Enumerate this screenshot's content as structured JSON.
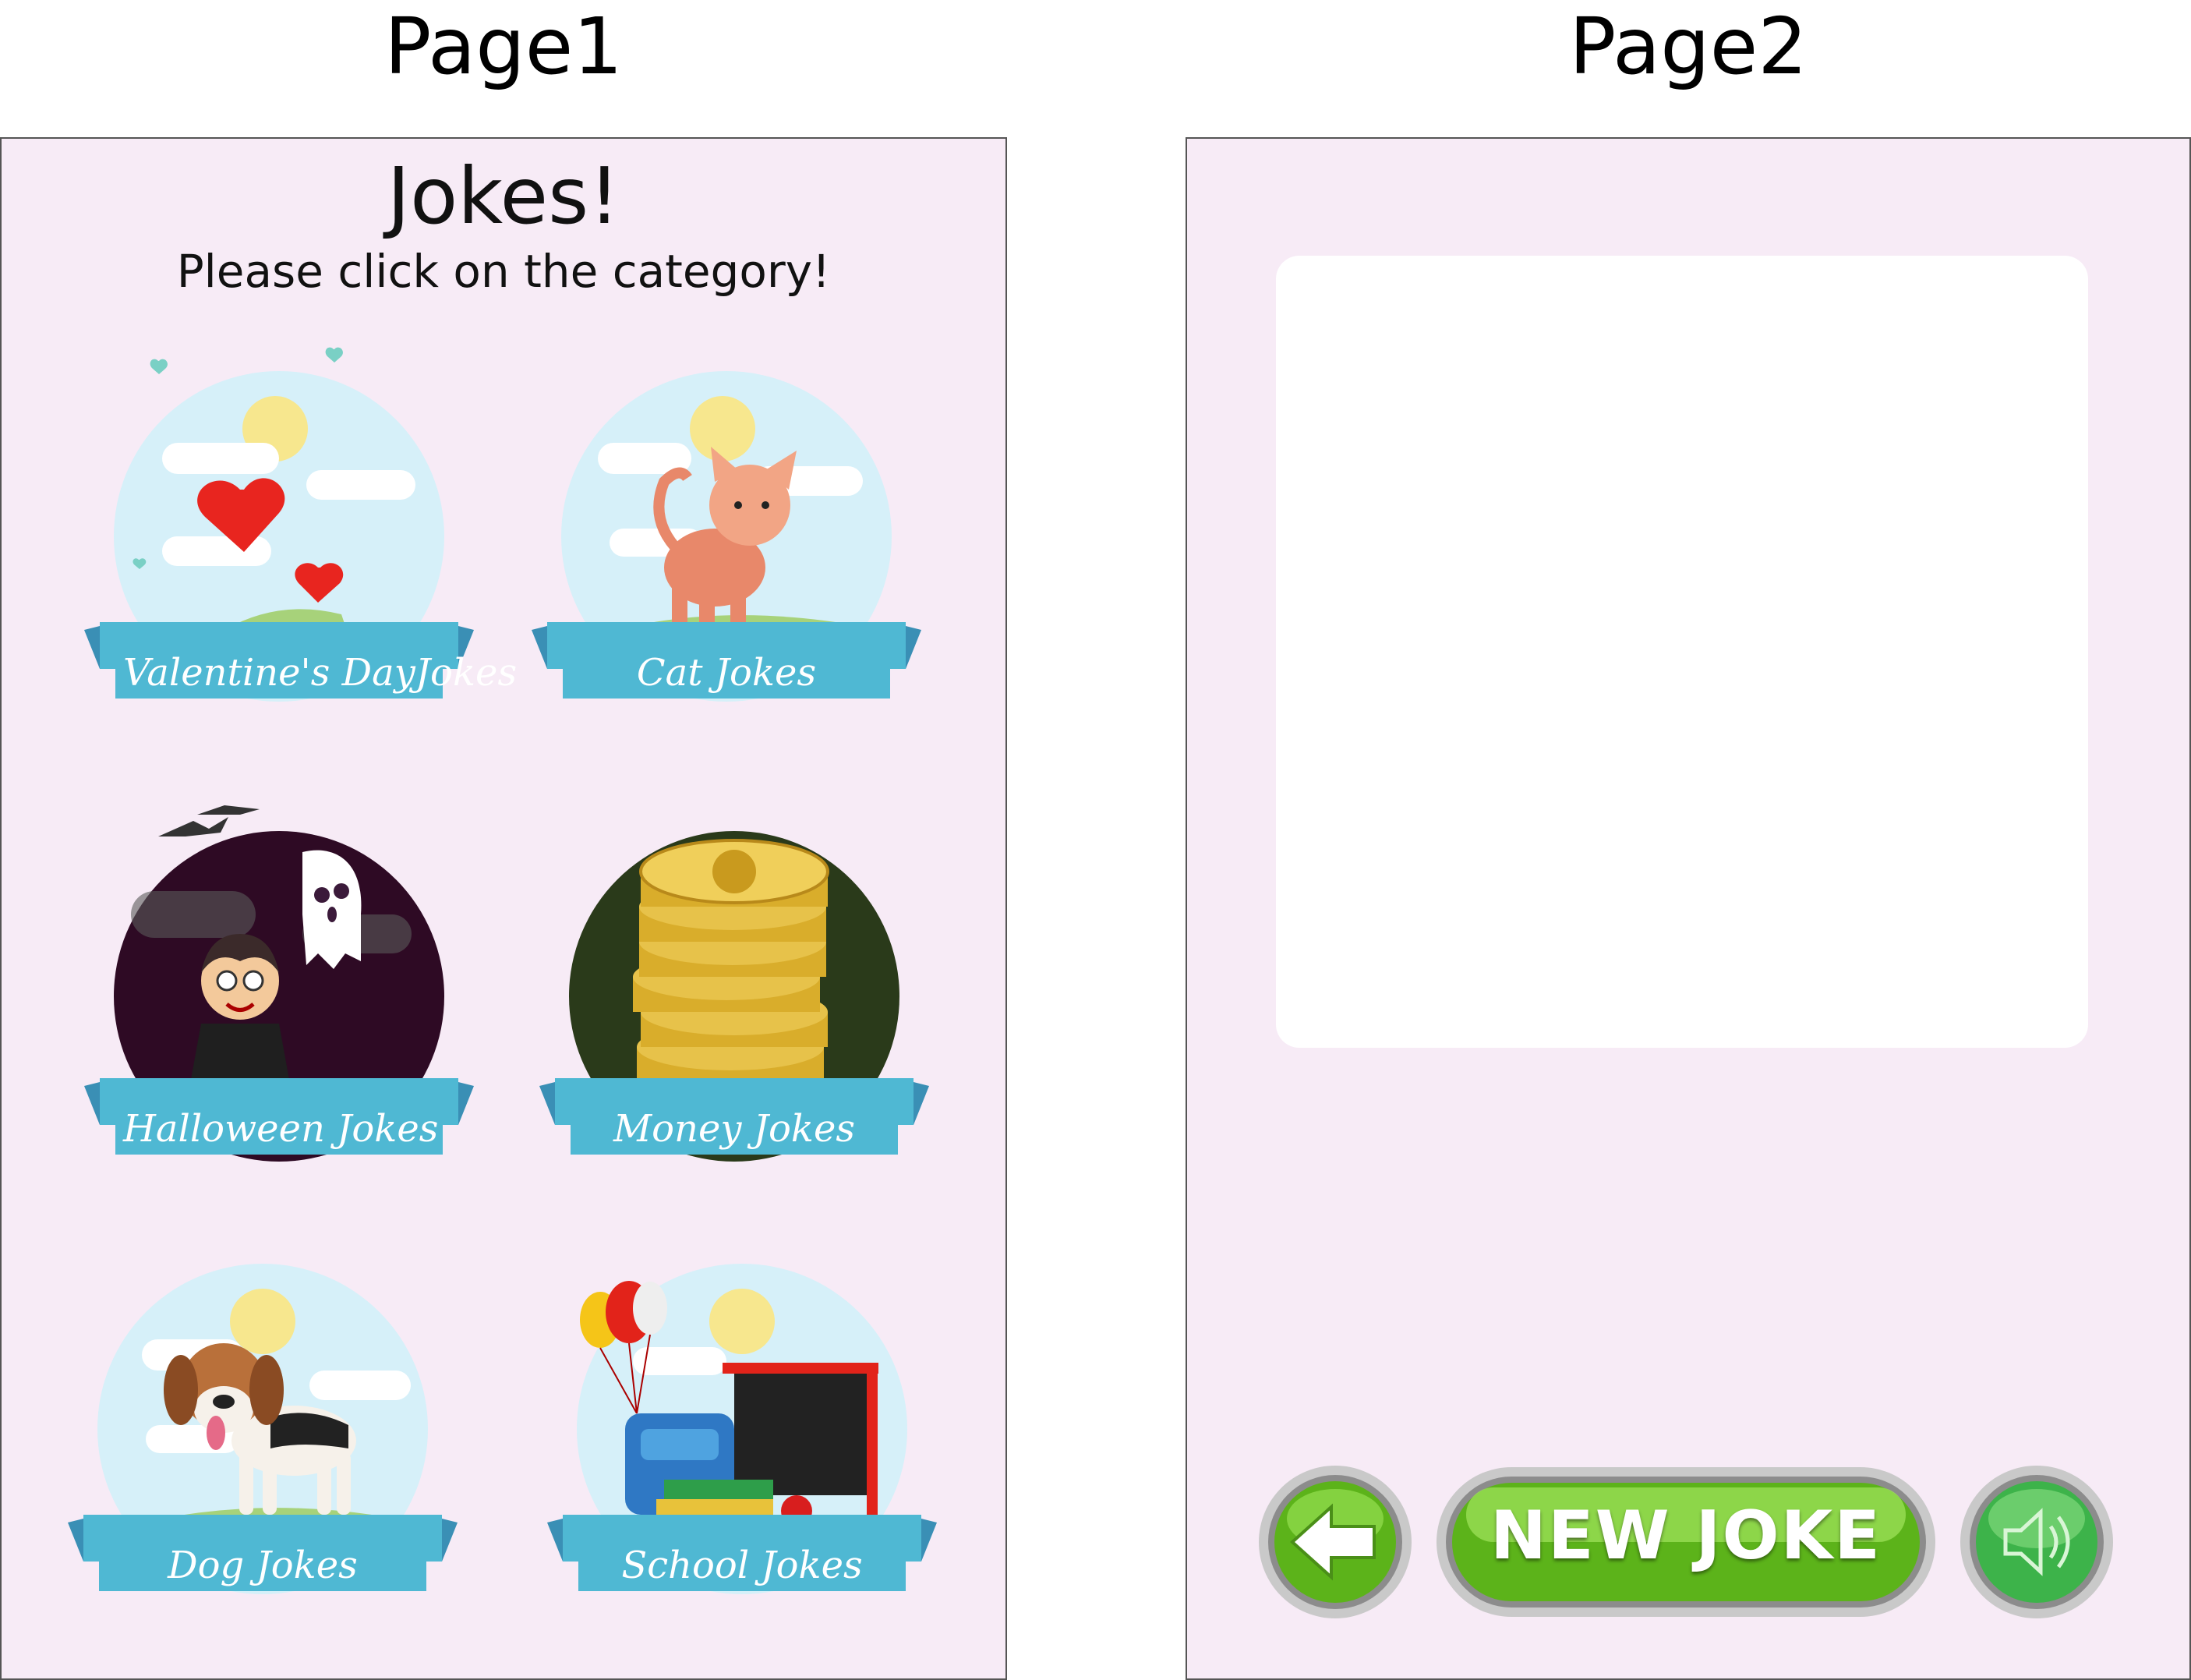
{
  "labels": {
    "page1": "Page1",
    "page2": "Page2"
  },
  "page1": {
    "title": "Jokes!",
    "subtitle": "Please click  on the category!",
    "categories": [
      {
        "label": "Valentine's DayJokes",
        "theme": "hearts-icon"
      },
      {
        "label": "Cat Jokes",
        "theme": "cat-icon"
      },
      {
        "label": "Halloween Jokes",
        "theme": "vampire-ghost-icon"
      },
      {
        "label": "Money Jokes",
        "theme": "coins-icon"
      },
      {
        "label": "Dog Jokes",
        "theme": "dog-icon"
      },
      {
        "label": "School Jokes",
        "theme": "school-supplies-icon"
      }
    ]
  },
  "page2": {
    "joke_text": "",
    "buttons": {
      "back": "back-arrow-icon",
      "new_joke": "NEW JOKE",
      "sound": "speaker-icon"
    }
  },
  "colors": {
    "page_bg": "#f7ebf6",
    "ribbon": "#4fb8d3",
    "ribbon_dark": "#3a8fb5",
    "sky": "#d6f0f9",
    "button_green": "#5cb31a"
  }
}
